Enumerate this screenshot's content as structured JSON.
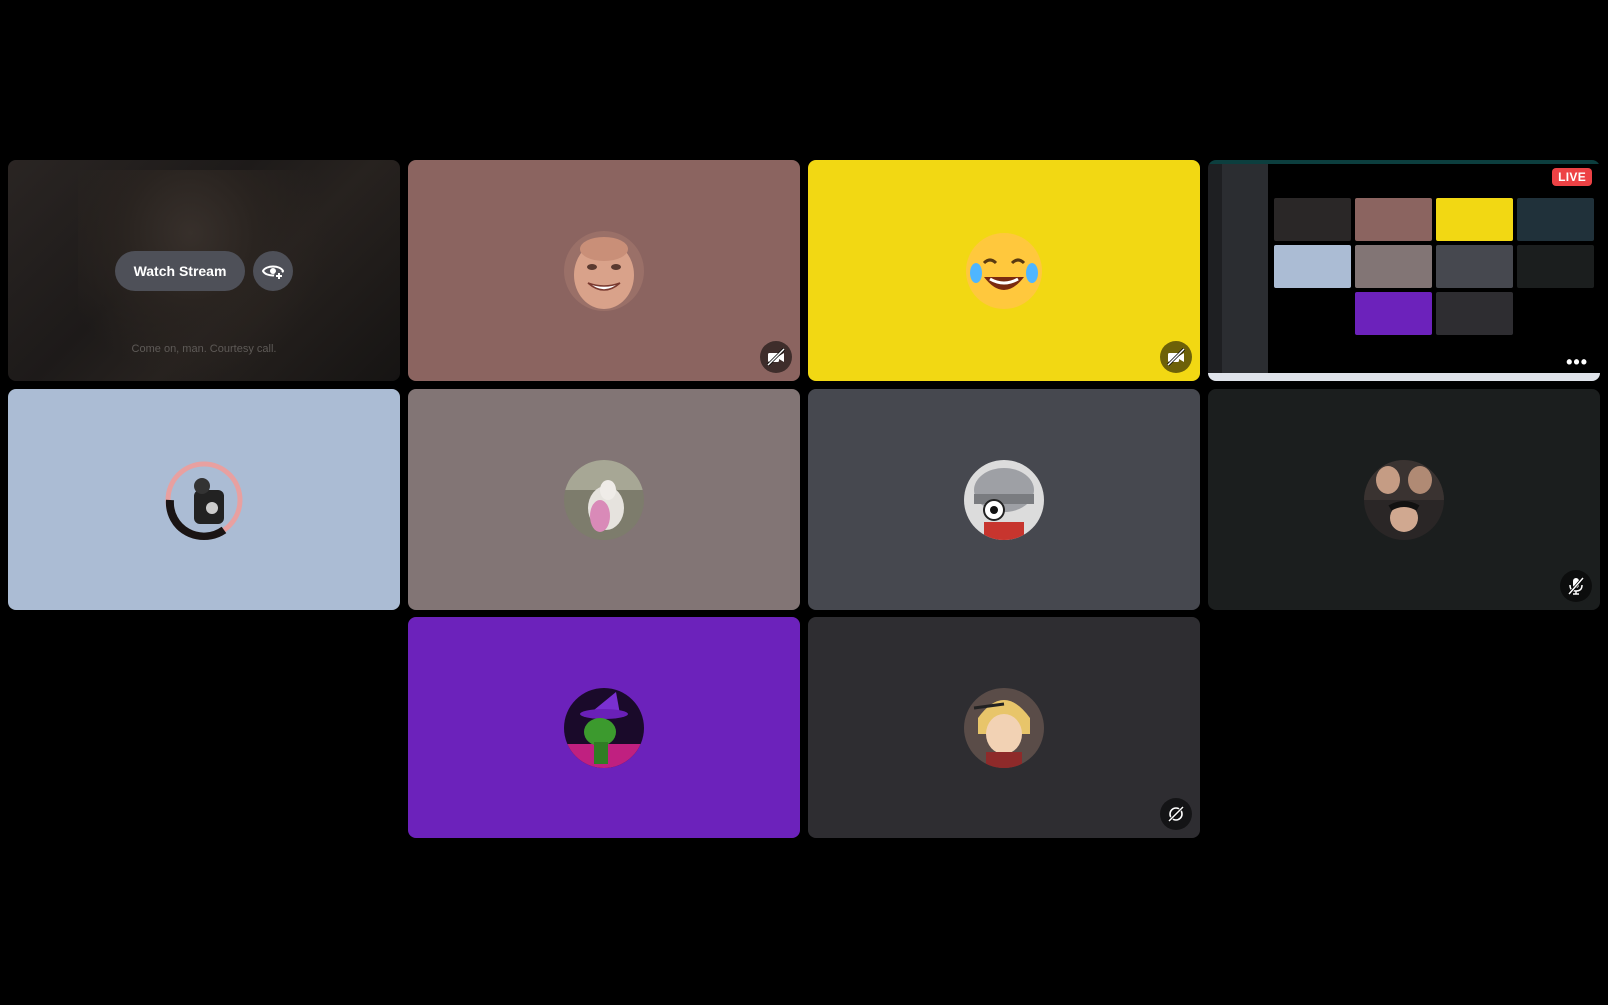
{
  "stream_preview": {
    "watch_label": "Watch Stream",
    "caption": "Come on, man. Courtesy call."
  },
  "screen_share": {
    "live_label": "LIVE",
    "more_label": "•••"
  },
  "tiles": [
    {
      "name": "stream-preview",
      "background": "#211d1b"
    },
    {
      "name": "participant-1",
      "background": "#8b6460",
      "status": "camera-off-icon"
    },
    {
      "name": "participant-2",
      "background": "#f2d813",
      "status": "camera-off-icon"
    },
    {
      "name": "screen-share",
      "background": "#000000"
    },
    {
      "name": "participant-3",
      "background": "#abbcd4"
    },
    {
      "name": "participant-4",
      "background": "#827575"
    },
    {
      "name": "participant-5",
      "background": "#46484f"
    },
    {
      "name": "participant-6",
      "background": "#1b1e1e",
      "status": "mic-muted-icon"
    },
    {
      "name": "participant-7",
      "background": "#6c22bb"
    },
    {
      "name": "participant-8",
      "background": "#2e2d31",
      "status": "stream-off-icon"
    }
  ]
}
